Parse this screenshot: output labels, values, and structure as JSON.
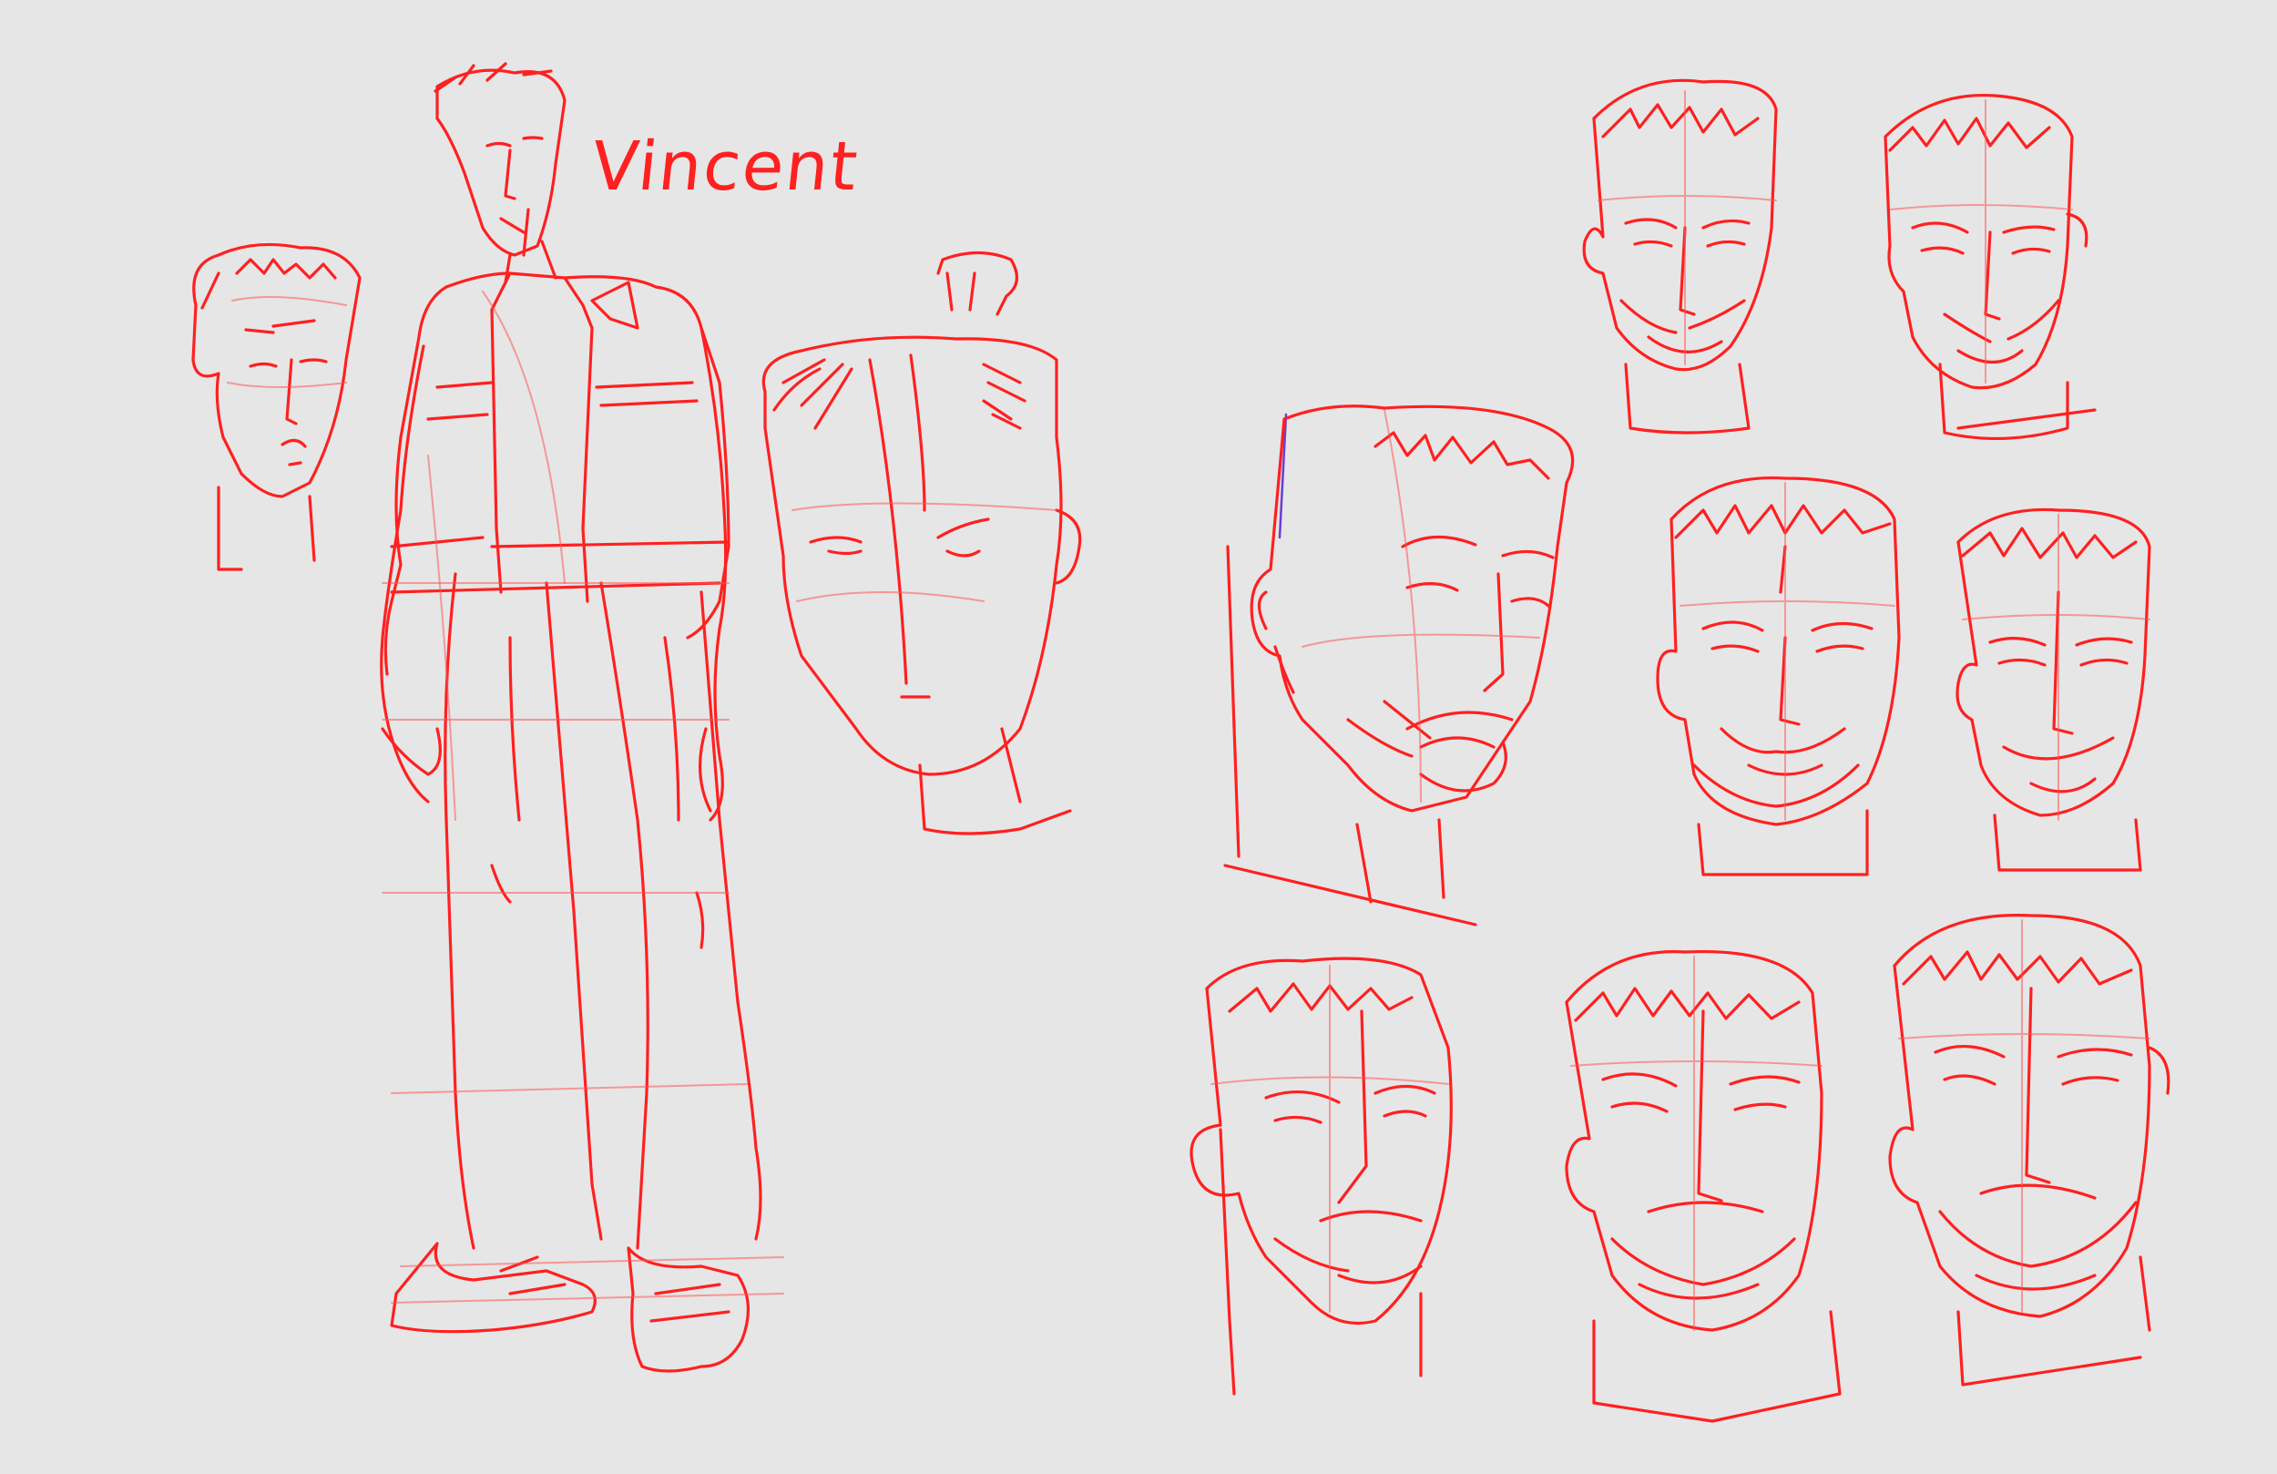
{
  "sheet": {
    "name_label": "Vincent",
    "background_color": "#e6e6e6",
    "ink_color": "#ff2020",
    "accent_ink_color": "#6a3cd8"
  }
}
